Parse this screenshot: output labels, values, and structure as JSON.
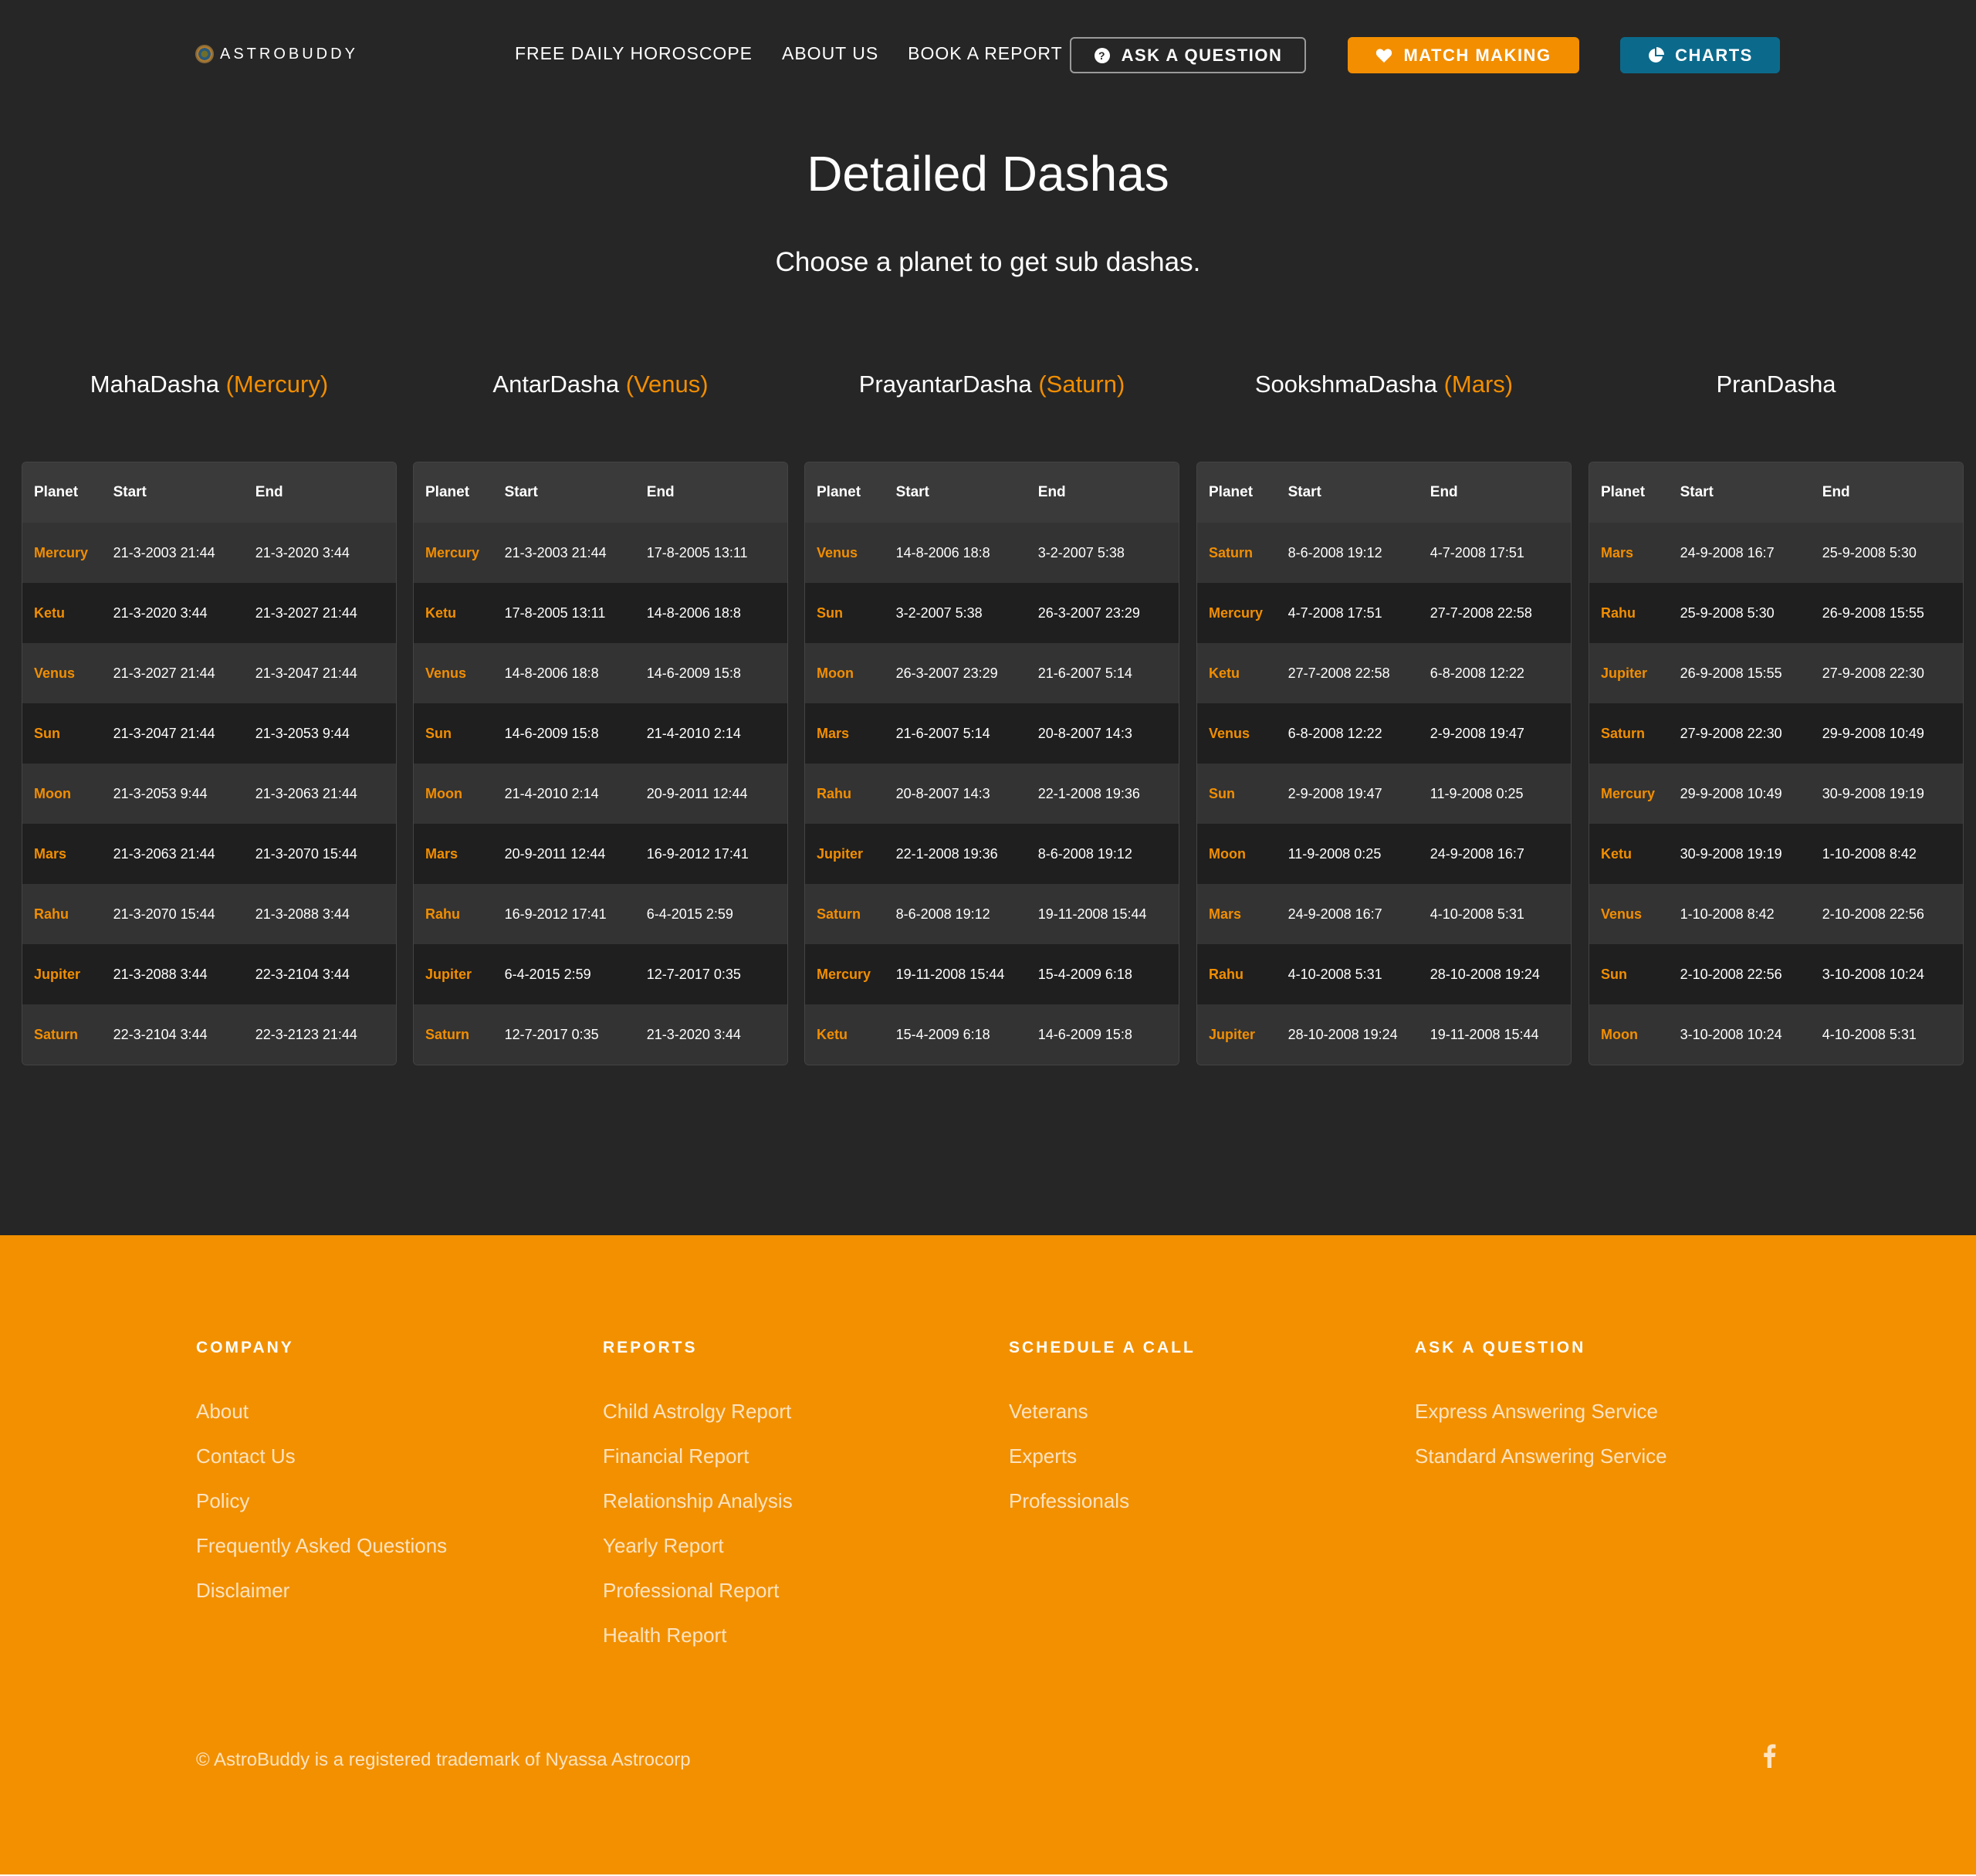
{
  "header": {
    "logo_text": "ASTROBUDDY",
    "nav": [
      "FREE DAILY HOROSCOPE",
      "ABOUT US",
      "BOOK A REPORT"
    ],
    "ask_label": "ASK A QUESTION",
    "match_label": "MATCH MAKING",
    "charts_label": "CHARTS"
  },
  "page": {
    "title": "Detailed Dashas",
    "subtitle": "Choose a planet to get sub dashas."
  },
  "table_headers": {
    "planet": "Planet",
    "start": "Start",
    "end": "End"
  },
  "columns": [
    {
      "name": "MahaDasha",
      "selected": "(Mercury)",
      "rows": [
        [
          "Mercury",
          "21-3-2003 21:44",
          "21-3-2020 3:44"
        ],
        [
          "Ketu",
          "21-3-2020 3:44",
          "21-3-2027 21:44"
        ],
        [
          "Venus",
          "21-3-2027 21:44",
          "21-3-2047 21:44"
        ],
        [
          "Sun",
          "21-3-2047 21:44",
          "21-3-2053 9:44"
        ],
        [
          "Moon",
          "21-3-2053 9:44",
          "21-3-2063 21:44"
        ],
        [
          "Mars",
          "21-3-2063 21:44",
          "21-3-2070 15:44"
        ],
        [
          "Rahu",
          "21-3-2070 15:44",
          "21-3-2088 3:44"
        ],
        [
          "Jupiter",
          "21-3-2088 3:44",
          "22-3-2104 3:44"
        ],
        [
          "Saturn",
          "22-3-2104 3:44",
          "22-3-2123 21:44"
        ]
      ]
    },
    {
      "name": "AntarDasha",
      "selected": "(Venus)",
      "rows": [
        [
          "Mercury",
          "21-3-2003 21:44",
          "17-8-2005 13:11"
        ],
        [
          "Ketu",
          "17-8-2005 13:11",
          "14-8-2006 18:8"
        ],
        [
          "Venus",
          "14-8-2006 18:8",
          "14-6-2009 15:8"
        ],
        [
          "Sun",
          "14-6-2009 15:8",
          "21-4-2010 2:14"
        ],
        [
          "Moon",
          "21-4-2010 2:14",
          "20-9-2011 12:44"
        ],
        [
          "Mars",
          "20-9-2011 12:44",
          "16-9-2012 17:41"
        ],
        [
          "Rahu",
          "16-9-2012 17:41",
          "6-4-2015 2:59"
        ],
        [
          "Jupiter",
          "6-4-2015 2:59",
          "12-7-2017 0:35"
        ],
        [
          "Saturn",
          "12-7-2017 0:35",
          "21-3-2020 3:44"
        ]
      ]
    },
    {
      "name": "PrayantarDasha",
      "selected": "(Saturn)",
      "rows": [
        [
          "Venus",
          "14-8-2006 18:8",
          "3-2-2007 5:38"
        ],
        [
          "Sun",
          "3-2-2007 5:38",
          "26-3-2007 23:29"
        ],
        [
          "Moon",
          "26-3-2007 23:29",
          "21-6-2007 5:14"
        ],
        [
          "Mars",
          "21-6-2007 5:14",
          "20-8-2007 14:3"
        ],
        [
          "Rahu",
          "20-8-2007 14:3",
          "22-1-2008 19:36"
        ],
        [
          "Jupiter",
          "22-1-2008 19:36",
          "8-6-2008 19:12"
        ],
        [
          "Saturn",
          "8-6-2008 19:12",
          "19-11-2008 15:44"
        ],
        [
          "Mercury",
          "19-11-2008 15:44",
          "15-4-2009 6:18"
        ],
        [
          "Ketu",
          "15-4-2009 6:18",
          "14-6-2009 15:8"
        ]
      ]
    },
    {
      "name": "SookshmaDasha",
      "selected": "(Mars)",
      "rows": [
        [
          "Saturn",
          "8-6-2008 19:12",
          "4-7-2008 17:51"
        ],
        [
          "Mercury",
          "4-7-2008 17:51",
          "27-7-2008 22:58"
        ],
        [
          "Ketu",
          "27-7-2008 22:58",
          "6-8-2008 12:22"
        ],
        [
          "Venus",
          "6-8-2008 12:22",
          "2-9-2008 19:47"
        ],
        [
          "Sun",
          "2-9-2008 19:47",
          "11-9-2008 0:25"
        ],
        [
          "Moon",
          "11-9-2008 0:25",
          "24-9-2008 16:7"
        ],
        [
          "Mars",
          "24-9-2008 16:7",
          "4-10-2008 5:31"
        ],
        [
          "Rahu",
          "4-10-2008 5:31",
          "28-10-2008 19:24"
        ],
        [
          "Jupiter",
          "28-10-2008 19:24",
          "19-11-2008 15:44"
        ]
      ]
    },
    {
      "name": "PranDasha",
      "selected": "",
      "rows": [
        [
          "Mars",
          "24-9-2008 16:7",
          "25-9-2008 5:30"
        ],
        [
          "Rahu",
          "25-9-2008 5:30",
          "26-9-2008 15:55"
        ],
        [
          "Jupiter",
          "26-9-2008 15:55",
          "27-9-2008 22:30"
        ],
        [
          "Saturn",
          "27-9-2008 22:30",
          "29-9-2008 10:49"
        ],
        [
          "Mercury",
          "29-9-2008 10:49",
          "30-9-2008 19:19"
        ],
        [
          "Ketu",
          "30-9-2008 19:19",
          "1-10-2008 8:42"
        ],
        [
          "Venus",
          "1-10-2008 8:42",
          "2-10-2008 22:56"
        ],
        [
          "Sun",
          "2-10-2008 22:56",
          "3-10-2008 10:24"
        ],
        [
          "Moon",
          "3-10-2008 10:24",
          "4-10-2008 5:31"
        ]
      ]
    }
  ],
  "footer": {
    "columns": [
      {
        "heading": "COMPANY",
        "links": [
          "About",
          "Contact Us",
          "Policy",
          "Frequently Asked Questions",
          "Disclaimer"
        ]
      },
      {
        "heading": "REPORTS",
        "links": [
          "Child Astrolgy Report",
          "Financial Report",
          "Relationship Analysis",
          "Yearly Report",
          "Professional Report",
          "Health Report"
        ]
      },
      {
        "heading": "SCHEDULE A CALL",
        "links": [
          "Veterans",
          "Experts",
          "Professionals"
        ]
      },
      {
        "heading": "ASK A QUESTION",
        "links": [
          "Express Answering Service",
          "Standard Answering Service"
        ]
      }
    ],
    "copyright": "© AstroBuddy is a registered trademark of Nyassa Astrocorp"
  },
  "colors": {
    "accent": "#f28e00",
    "charts_button": "#0b6a8c",
    "background": "#262626"
  },
  "icons": {
    "ask": "question-circle-icon",
    "match": "heart-icon",
    "charts": "pie-chart-icon",
    "social": "facebook-icon"
  }
}
